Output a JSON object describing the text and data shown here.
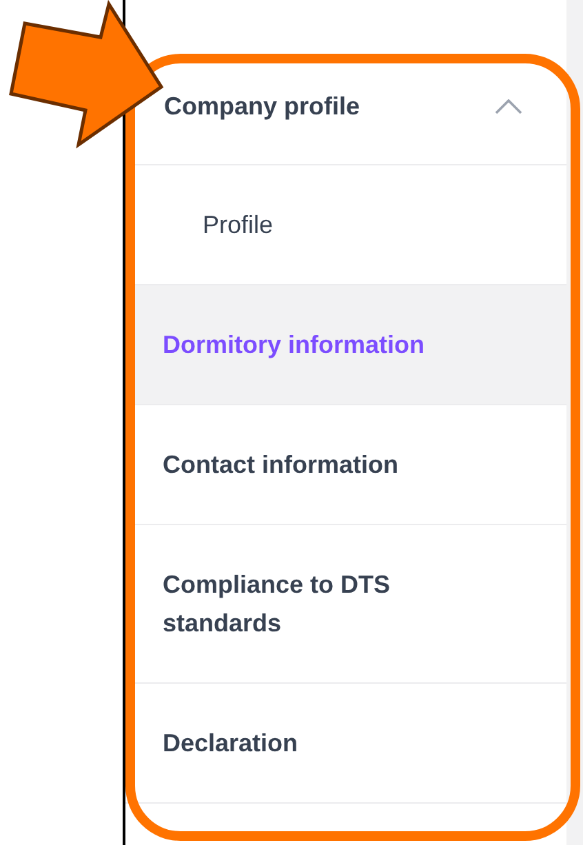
{
  "menu": {
    "title": "Company profile",
    "expanded": true,
    "items": [
      {
        "label": "Profile",
        "kind": "subitem",
        "selected": false
      },
      {
        "label": "Dormitory information",
        "kind": "item",
        "selected": true
      },
      {
        "label": "Contact information",
        "kind": "item",
        "selected": false
      },
      {
        "label": "Compliance to DTS standards",
        "kind": "item",
        "selected": false
      },
      {
        "label": "Declaration",
        "kind": "item",
        "selected": false
      }
    ]
  }
}
